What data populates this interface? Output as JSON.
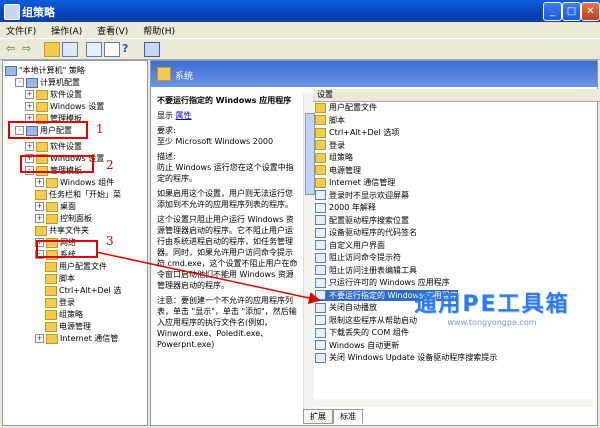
{
  "window": {
    "title": "组策略"
  },
  "menu": [
    "文件(F)",
    "操作(A)",
    "查看(V)",
    "帮助(H)"
  ],
  "tree": [
    {
      "label": "\"本地计算机\" 策略",
      "indent": 0,
      "icon": "pc",
      "exp": ""
    },
    {
      "label": "计算机配置",
      "indent": 1,
      "icon": "pc",
      "exp": "-"
    },
    {
      "label": "软件设置",
      "indent": 2,
      "icon": "folder",
      "exp": "+"
    },
    {
      "label": "Windows 设置",
      "indent": 2,
      "icon": "folder",
      "exp": "+"
    },
    {
      "label": "管理模板",
      "indent": 2,
      "icon": "folder",
      "exp": "+"
    },
    {
      "label": "用户配置",
      "indent": 1,
      "icon": "pc",
      "exp": "-"
    },
    {
      "label": "软件设置",
      "indent": 2,
      "icon": "folder",
      "exp": "+"
    },
    {
      "label": "Windows 设置",
      "indent": 2,
      "icon": "folder",
      "exp": "+"
    },
    {
      "label": "管理模板",
      "indent": 2,
      "icon": "folder",
      "exp": "-"
    },
    {
      "label": "Windows 组件",
      "indent": 3,
      "icon": "folder",
      "exp": "+"
    },
    {
      "label": "任务栏和「开始」菜",
      "indent": 3,
      "icon": "folder",
      "exp": ""
    },
    {
      "label": "桌面",
      "indent": 3,
      "icon": "folder",
      "exp": "+"
    },
    {
      "label": "控制面板",
      "indent": 3,
      "icon": "folder",
      "exp": "+"
    },
    {
      "label": "共享文件夹",
      "indent": 3,
      "icon": "folder",
      "exp": ""
    },
    {
      "label": "网络",
      "indent": 3,
      "icon": "folder",
      "exp": "+"
    },
    {
      "label": "系统",
      "indent": 3,
      "icon": "folder",
      "exp": "-"
    },
    {
      "label": "用户配置文件",
      "indent": 4,
      "icon": "folder",
      "exp": ""
    },
    {
      "label": "脚本",
      "indent": 4,
      "icon": "folder",
      "exp": ""
    },
    {
      "label": "Ctrl+Alt+Del 选",
      "indent": 4,
      "icon": "folder",
      "exp": ""
    },
    {
      "label": "登录",
      "indent": 4,
      "icon": "folder",
      "exp": ""
    },
    {
      "label": "组策略",
      "indent": 4,
      "icon": "folder",
      "exp": ""
    },
    {
      "label": "电源管理",
      "indent": 4,
      "icon": "folder",
      "exp": ""
    },
    {
      "label": "Internet 通信管",
      "indent": 3,
      "icon": "folder",
      "exp": "+"
    }
  ],
  "right_header": {
    "title": "系统"
  },
  "description": {
    "heading": "不要运行指定的 Windows 应用程序",
    "show_label": "显示",
    "properties_link": "属性",
    "req_label": "要求:",
    "req_text": "至少 Microsoft Windows 2000",
    "desc_label": "描述:",
    "desc_text1": "防止 Windows 运行您在这个设置中指定的程序。",
    "desc_text2": "如果启用这个设置，用户则无法运行您添加到不允许的应用程序列表的程序。",
    "desc_text3": "这个设置只阻止用户运行 Windows 资源管理器启动的程序。它不阻止用户运行由系统进程启动的程序，如任务管理器。同时，如果允许用户访问命令提示符 cmd.exe，这个设置不阻止用户在命令窗口启动他们不能用 Windows 资源管理器启动的程序。",
    "desc_text4": "注意：要创建一个不允许的应用程序列表，单击 \"显示\"，单击 \"添加\"，然后输入应用程序的执行文件名(例如，Winword.exe、Poledit.exe、Powerpnt.exe)"
  },
  "list_header": "设置",
  "list": [
    {
      "label": "用户配置文件",
      "icon": "folder"
    },
    {
      "label": "脚本",
      "icon": "folder"
    },
    {
      "label": "Ctrl+Alt+Del 选项",
      "icon": "folder"
    },
    {
      "label": "登录",
      "icon": "folder"
    },
    {
      "label": "组策略",
      "icon": "folder"
    },
    {
      "label": "电源管理",
      "icon": "folder"
    },
    {
      "label": "Internet 通信管理",
      "icon": "folder"
    },
    {
      "label": "登录时不显示欢迎屏幕",
      "icon": "setting"
    },
    {
      "label": "2000 年解释",
      "icon": "setting"
    },
    {
      "label": "配置驱动程序搜索位置",
      "icon": "setting"
    },
    {
      "label": "设备驱动程序的代码签名",
      "icon": "setting"
    },
    {
      "label": "自定义用户界面",
      "icon": "setting"
    },
    {
      "label": "阻止访问命令提示符",
      "icon": "setting"
    },
    {
      "label": "阻止访问注册表编辑工具",
      "icon": "setting"
    },
    {
      "label": "只运行许可的 Windows 应用程序",
      "icon": "setting"
    },
    {
      "label": "不要运行指定的 Windows 应用程序",
      "icon": "setting",
      "selected": true
    },
    {
      "label": "关闭自动播放",
      "icon": "setting"
    },
    {
      "label": "限制这些程序从帮助启动",
      "icon": "setting"
    },
    {
      "label": "下载丢失的 COM 组件",
      "icon": "setting"
    },
    {
      "label": "Windows 自动更新",
      "icon": "setting"
    },
    {
      "label": "关闭 Windows Update 设备驱动程序搜索提示",
      "icon": "setting"
    }
  ],
  "tabs": [
    "扩展",
    "标准"
  ],
  "annotations": [
    "1",
    "2",
    "3"
  ],
  "watermark": {
    "main": "通用PE工具箱",
    "url": "www.tongyongpe.com"
  }
}
